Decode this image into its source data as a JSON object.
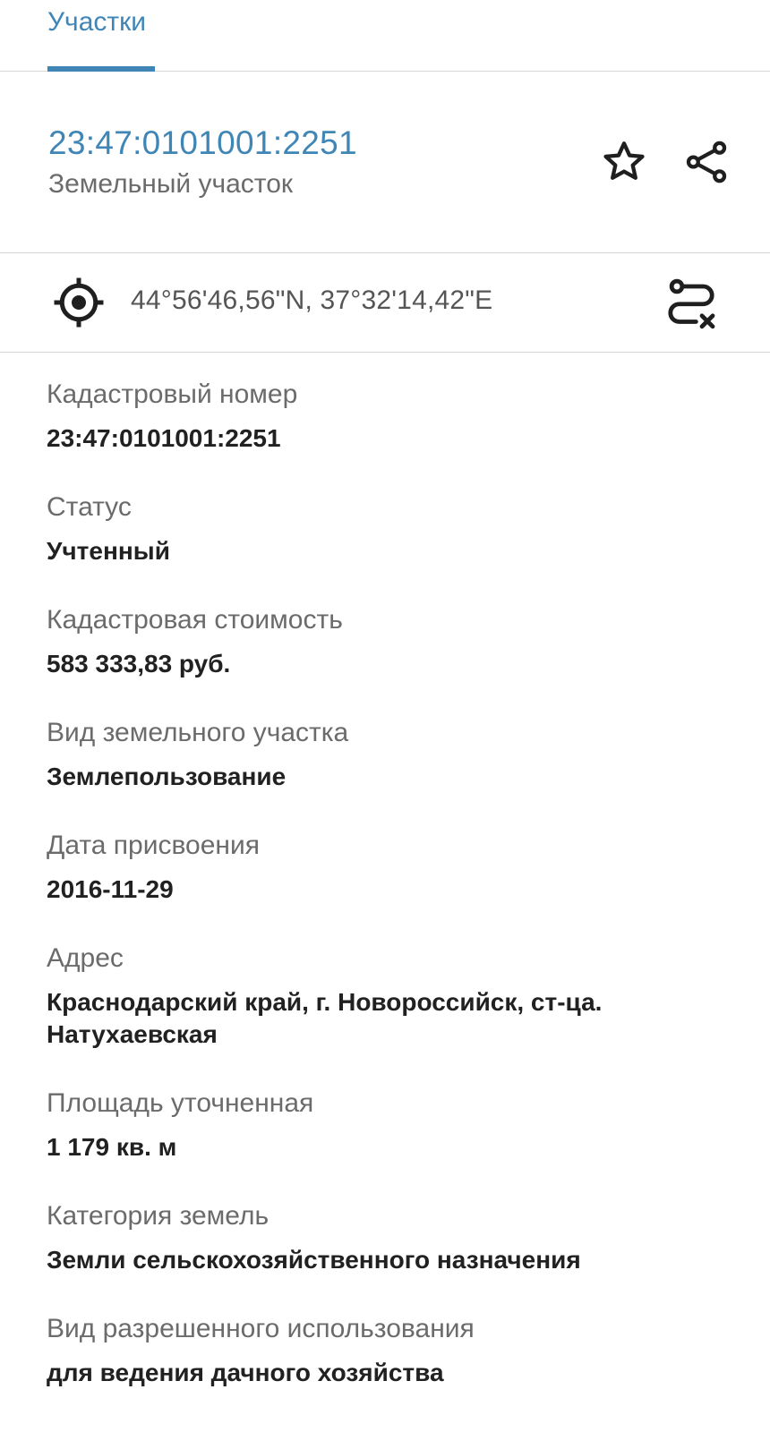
{
  "tabs": [
    {
      "label": "Участки"
    }
  ],
  "header": {
    "title": "23:47:0101001:2251",
    "subtitle": "Земельный участок"
  },
  "icons": {
    "star": "star-icon",
    "share": "share-icon",
    "locate": "crosshair-icon",
    "route": "route-clear-icon"
  },
  "coords": "44°56'46,56\"N, 37°32'14,42\"E",
  "fields": [
    {
      "label": "Кадастровый номер",
      "value": "23:47:0101001:2251"
    },
    {
      "label": "Статус",
      "value": "Учтенный"
    },
    {
      "label": "Кадастровая стоимость",
      "value": "583 333,83 руб."
    },
    {
      "label": "Вид земельного участка",
      "value": "Землепользование"
    },
    {
      "label": "Дата присвоения",
      "value": "2016-11-29"
    },
    {
      "label": "Адрес",
      "value": "Краснодарский край, г. Новороссийск, ст-ца. Натухаевская"
    },
    {
      "label": "Площадь уточненная",
      "value": "1 179 кв. м"
    },
    {
      "label": "Категория земель",
      "value": "Земли сельскохозяйственного назначения"
    },
    {
      "label": "Вид разрешенного использования",
      "value": "для ведения дачного хозяйства"
    }
  ],
  "colors": {
    "accent": "#3f86b7",
    "label": "#6b6b6b",
    "value": "#212121",
    "divider": "#d6d6d6"
  }
}
